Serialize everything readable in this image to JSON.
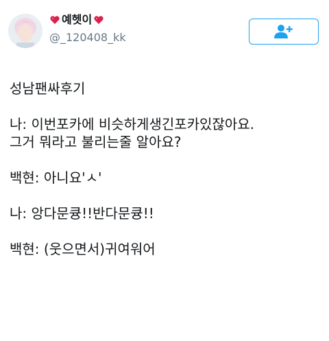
{
  "header": {
    "display_name": "예헷이",
    "handle": "@_120408_kk",
    "icons": {
      "left_heart": "heart-icon",
      "right_heart": "heart-icon",
      "follow": "add-user-icon"
    },
    "colors": {
      "accent": "#1da1f2",
      "heart": "#d9214b",
      "handle": "#657786"
    }
  },
  "tweet": {
    "lines": [
      "성남팬싸후기",
      "나: 이번포카에 비슷하게생긴포카있잖아요.",
      "그거 뭐라고 불리는줄 알아요?",
      "백현: 아니요'ㅅ'",
      "나: 앙다문큥!!반다문큥!!",
      "백현: (웃으면서)귀여워어"
    ]
  }
}
